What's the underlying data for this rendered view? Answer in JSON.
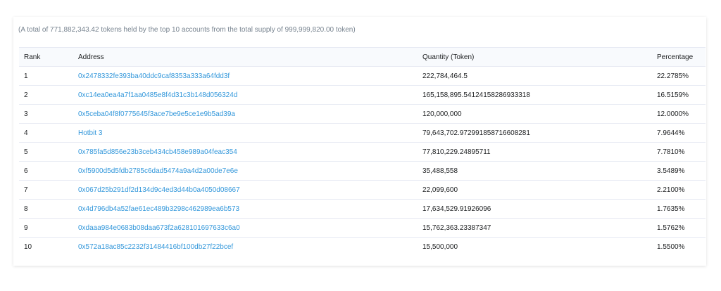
{
  "summary": "(A total of 771,882,343.42 tokens held by the top 10 accounts from the total supply of 999,999,820.00 token)",
  "columns": {
    "rank": "Rank",
    "address": "Address",
    "quantity": "Quantity (Token)",
    "percentage": "Percentage"
  },
  "rows": [
    {
      "rank": "1",
      "address": "0x2478332fe393ba40ddc9caf8353a333a64fdd3f",
      "quantity": "222,784,464.5",
      "percentage": "22.2785%"
    },
    {
      "rank": "2",
      "address": "0xc14ea0ea4a7f1aa0485e8f4d31c3b148d056324d",
      "quantity": "165,158,895.54124158286933318",
      "percentage": "16.5159%"
    },
    {
      "rank": "3",
      "address": "0x5ceba04f8f0775645f3ace7be9e5ce1e9b5ad39a",
      "quantity": "120,000,000",
      "percentage": "12.0000%"
    },
    {
      "rank": "4",
      "address": "Hotbit 3",
      "quantity": "79,643,702.972991858716608281",
      "percentage": "7.9644%"
    },
    {
      "rank": "5",
      "address": "0x785fa5d856e23b3ceb434cb458e989a04feac354",
      "quantity": "77,810,229.24895711",
      "percentage": "7.7810%"
    },
    {
      "rank": "6",
      "address": "0xf5900d5d5fdb2785c6dad5474a9a4d2a00de7e6e",
      "quantity": "35,488,558",
      "percentage": "3.5489%"
    },
    {
      "rank": "7",
      "address": "0x067d25b291df2d134d9c4ed3d44b0a4050d08667",
      "quantity": "22,099,600",
      "percentage": "2.2100%"
    },
    {
      "rank": "8",
      "address": "0x4d796db4a52fae61ec489b3298c462989ea6b573",
      "quantity": "17,634,529.91926096",
      "percentage": "1.7635%"
    },
    {
      "rank": "9",
      "address": "0xdaaa984e0683b08daa673f2a628101697633c6a0",
      "quantity": "15,762,363.23387347",
      "percentage": "1.5762%"
    },
    {
      "rank": "10",
      "address": "0x572a18ac85c2232f31484416bf100db27f22bcef",
      "quantity": "15,500,000",
      "percentage": "1.5500%"
    }
  ],
  "colors": {
    "link": "#3498db",
    "border": "#e7eaf3",
    "header_bg": "#f8fafd",
    "muted_text": "#77838f"
  }
}
